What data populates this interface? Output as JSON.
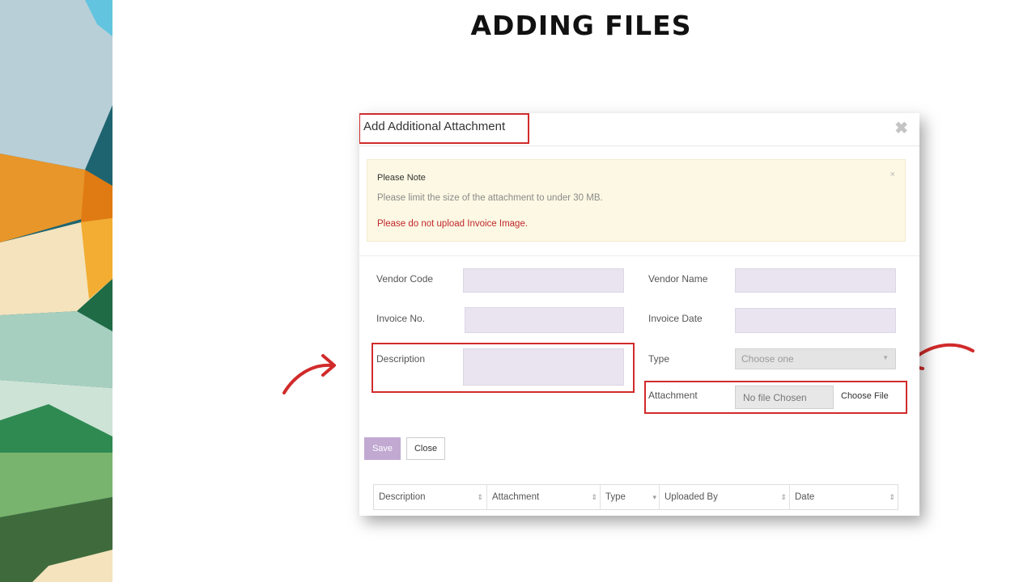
{
  "slide": {
    "title": "ADDING FILES"
  },
  "modal": {
    "title": "Add Additional Attachment",
    "close_glyph": "✖",
    "alert": {
      "heading": "Please Note",
      "line1": "Please limit the size of the attachment to under 30 MB.",
      "warning": "Please do not upload Invoice Image.",
      "close_glyph": "×"
    },
    "form": {
      "vendor_code_label": "Vendor Code",
      "vendor_name_label": "Vendor Name",
      "invoice_no_label": "Invoice No.",
      "invoice_date_label": "Invoice Date",
      "description_label": "Description",
      "type_label": "Type",
      "type_value": "Choose one",
      "attachment_label": "Attachment",
      "file_status": "No file Chosen",
      "choose_file_label": "Choose File"
    },
    "buttons": {
      "save": "Save",
      "close": "Close"
    },
    "table": {
      "columns": [
        "Description",
        "Attachment",
        "Type",
        "Uploaded By",
        "Date"
      ]
    }
  },
  "colors": {
    "highlight": "#d12b2b",
    "field_bg": "#e9e4f0",
    "alert_bg": "#fcf8e3",
    "save_bg": "#c1a9d2"
  }
}
